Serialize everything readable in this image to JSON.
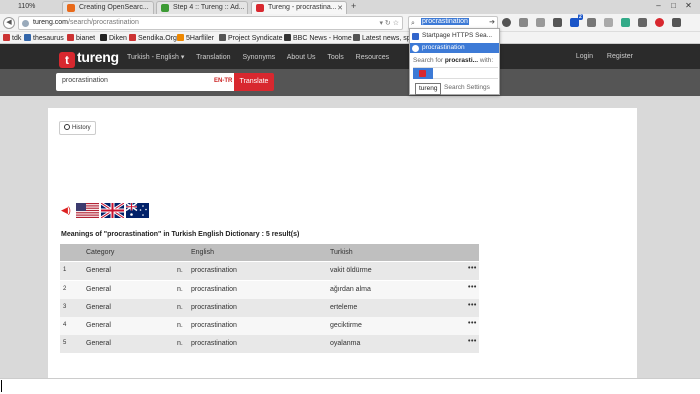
{
  "browser": {
    "zoom": "110%",
    "tabs": [
      {
        "title": "Creating OpenSearc...",
        "favicon_color": "#e86a1b"
      },
      {
        "title": "Step 4 :: Tureng :: Ad...",
        "favicon_color": "#3d9b35"
      },
      {
        "title": "Tureng - procrastina...",
        "favicon_color": "#d8282f"
      }
    ],
    "url_host": "tureng.com",
    "url_path": "/search/procrastination",
    "search_value": "procrastination",
    "bookmarks": [
      "tdk",
      "thesaurus",
      "bianet",
      "Diken",
      "Sendika.Org",
      "5Harfliler",
      "Project Syndicate",
      "BBC News - Home",
      "Latest news, sp"
    ]
  },
  "search_dropdown": {
    "suggestions": [
      "Startpage HTTPS Sea...",
      "procrastination"
    ],
    "search_for_prefix": "Search for",
    "search_for_term": "procrasti...",
    "search_for_suffix": "with:",
    "tooltip": "tureng",
    "settings": "Search Settings"
  },
  "site": {
    "logo": "tureng",
    "nav": [
      "Turkish - English ▾",
      "Translation",
      "Synonyms",
      "About Us",
      "Tools",
      "Resources"
    ],
    "login": "Login",
    "register": "Register",
    "query": "procrastination",
    "lang_pair": "EN-TR",
    "translate": "Translate",
    "history": "History",
    "results_title": "Meanings of \"procrastination\" in Turkish English Dictionary : 5 result(s)",
    "columns": {
      "category": "Category",
      "english": "English",
      "turkish": "Turkish"
    },
    "rows": [
      {
        "n": "1",
        "category": "General",
        "pos": "n.",
        "english": "procrastination",
        "turkish": "vakit öldürme"
      },
      {
        "n": "2",
        "category": "General",
        "pos": "n.",
        "english": "procrastination",
        "turkish": "ağırdan alma"
      },
      {
        "n": "3",
        "category": "General",
        "pos": "n.",
        "english": "procrastination",
        "turkish": "erteleme"
      },
      {
        "n": "4",
        "category": "General",
        "pos": "n.",
        "english": "procrastination",
        "turkish": "geciktirme"
      },
      {
        "n": "5",
        "category": "General",
        "pos": "n.",
        "english": "procrastination",
        "turkish": "oyalanma"
      }
    ],
    "more": "•••"
  }
}
